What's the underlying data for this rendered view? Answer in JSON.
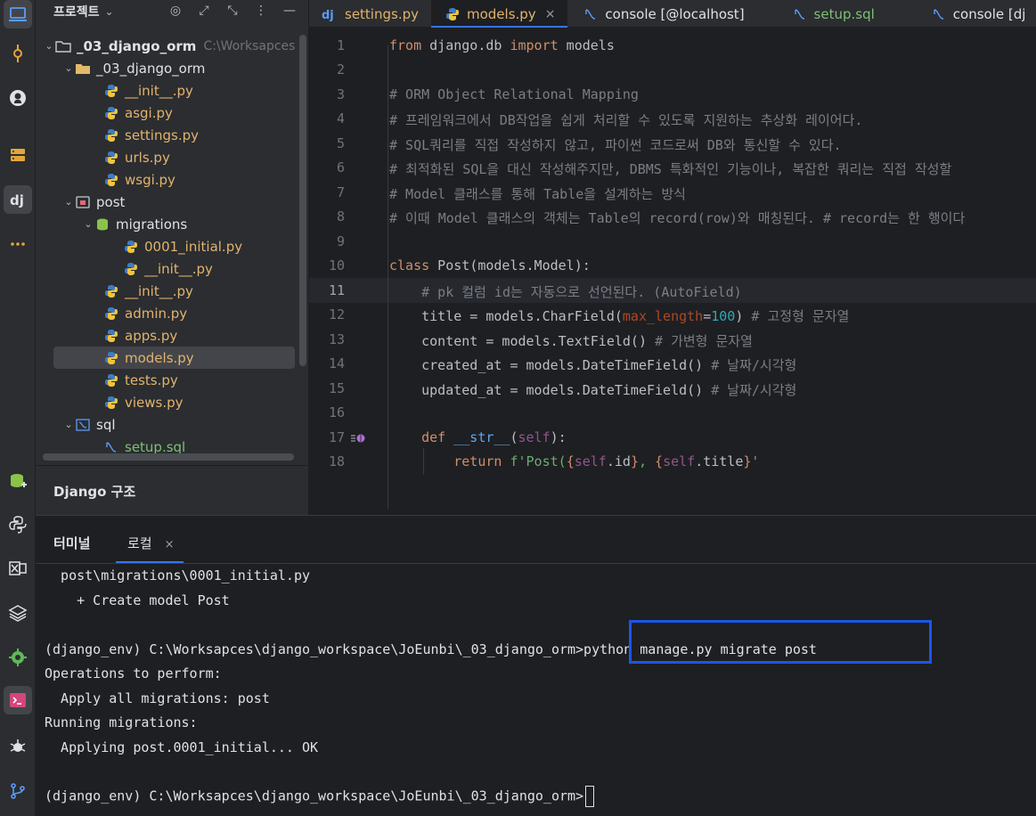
{
  "activity_bar": {
    "icons": [
      "laptop-icon",
      "commit-icon",
      "github-icon",
      "services-icon",
      "django-icon",
      "more-icon",
      "database-add-icon",
      "python-console-icon",
      "excel-icon",
      "layers-icon",
      "settings-icon",
      "terminal-icon",
      "debug-icon",
      "git-branch-icon"
    ]
  },
  "project": {
    "title": "프로젝트",
    "items": [
      {
        "label": "_03_django_orm",
        "hint": "C:\\Worksapces"
      },
      {
        "label": "_03_django_orm"
      },
      {
        "label": "__init__.py"
      },
      {
        "label": "asgi.py"
      },
      {
        "label": "settings.py"
      },
      {
        "label": "urls.py"
      },
      {
        "label": "wsgi.py"
      },
      {
        "label": "post"
      },
      {
        "label": "migrations"
      },
      {
        "label": "0001_initial.py"
      },
      {
        "label": "__init__.py"
      },
      {
        "label": "__init__.py"
      },
      {
        "label": "admin.py"
      },
      {
        "label": "apps.py"
      },
      {
        "label": "models.py"
      },
      {
        "label": "tests.py"
      },
      {
        "label": "views.py"
      },
      {
        "label": "sql"
      },
      {
        "label": "setup.sql"
      }
    ],
    "structure_title": "Django 구조"
  },
  "tabs": [
    {
      "label": "settings.py"
    },
    {
      "label": "models.py",
      "close": "×"
    },
    {
      "label": "console [@localhost]"
    },
    {
      "label": "setup.sql"
    },
    {
      "label": "console [dj"
    }
  ],
  "editor": {
    "line_numbers": [
      "1",
      "2",
      "3",
      "4",
      "5",
      "6",
      "7",
      "8",
      "9",
      "10",
      "11",
      "12",
      "13",
      "14",
      "15",
      "16",
      "17",
      "18"
    ],
    "code": {
      "l1_from": "from",
      "l1_mod": " django.db ",
      "l1_import": "import",
      "l1_rest": " models",
      "l3": "# ORM Object Relational Mapping",
      "l4": "# 프레임워크에서 DB작업을 쉽게 처리할 수 있도록 지원하는 추상화 레이어다.",
      "l5": "# SQL쿼리를 직접 작성하지 않고, 파이썬 코드로써 DB와 통신할 수 있다.",
      "l6": "# 최적화된 SQL을 대신 작성해주지만, DBMS 특화적인 기능이나, 복잡한 쿼리는 직접 작성할",
      "l7": "# Model 클래스를 통해 Table을 설계하는 방식",
      "l8": "# 이때 Model 클래스의 객체는 Table의 record(row)와 매칭된다. # record는 한 행이다",
      "l10_class": "class",
      "l10_name": " Post",
      "l10_rest": "(models.Model):",
      "l11": "    # pk 컬럼 id는 자동으로 선언된다. (AutoField)",
      "l12_a": "    title = models.CharField(",
      "l12_param": "max_length",
      "l12_eq": "=",
      "l12_num": "100",
      "l12_b": ") ",
      "l12_cm": "# 고정형 문자열",
      "l13_a": "    content = models.TextField() ",
      "l13_cm": "# 가변형 문자열",
      "l14_a": "    created_at = models.DateTimeField() ",
      "l14_cm": "# 날짜/시각형",
      "l15_a": "    updated_at = models.DateTimeField() ",
      "l15_cm": "# 날짜/시각형",
      "l17_indent": "    ",
      "l17_def": "def",
      "l17_sp": " ",
      "l17_fn": "__str__",
      "l17_open": "(",
      "l17_self": "self",
      "l17_close": "):",
      "l18_indent": "        ",
      "l18_return": "return",
      "l18_sp": " ",
      "l18_str1": "f'Post(",
      "l18_b1": "{",
      "l18_self1": "self",
      "l18_id": ".id",
      "l18_b2": "}",
      "l18_comma": ", ",
      "l18_b3": "{",
      "l18_self2": "self",
      "l18_title": ".title",
      "l18_b4": "}",
      "l18_str2": "'"
    }
  },
  "terminal": {
    "title": "터미널",
    "tab": "로컬",
    "close": "×",
    "lines": [
      "  post\\migrations\\0001_initial.py",
      "    + Create model Post",
      "",
      "(django_env) C:\\Worksapces\\django_workspace\\JoEunbi\\_03_django_orm>python manage.py migrate post",
      "Operations to perform:",
      "  Apply all migrations: post",
      "Running migrations:",
      "  Applying post.0001_initial... OK",
      "",
      "(django_env) C:\\Worksapces\\django_workspace\\JoEunbi\\_03_django_orm>"
    ]
  }
}
